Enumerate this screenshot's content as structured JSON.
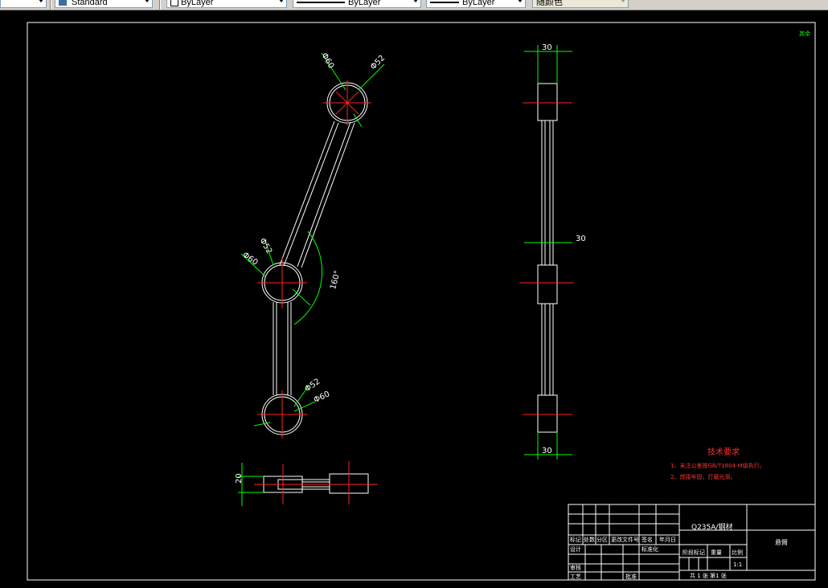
{
  "toolbar": {
    "combo1_value": "",
    "text_style": "Standard",
    "layer": "ByLayer",
    "linetype": "ByLayer",
    "lineweight": "ByLayer",
    "plot_style": "随颜色"
  },
  "drawing": {
    "corner_label": "其余",
    "dims": {
      "top_d60": "Φ60",
      "top_d52": "Φ52",
      "mid_d52": "Φ52",
      "mid_d60": "Φ60",
      "angle": "160°",
      "bot_d52": "Φ52",
      "bot_d60": "Φ60",
      "side_top_30": "30",
      "side_mid_30": "30",
      "side_bot_30": "30",
      "plan_20": "20"
    },
    "tech_req_title": "技术要求",
    "tech_req_1": "1、未注公差按GB/T1804-M级执行。",
    "tech_req_2": "2、焊接牢固，打磨光滑。",
    "title_block": {
      "material": "Q235A/钢材",
      "part_name": "悬臂",
      "h_mark": "标记",
      "h_count": "处数",
      "h_zone": "分区",
      "h_doc": "更改文件号",
      "h_sign": "签名",
      "h_date": "年月日",
      "h_design": "设计",
      "h_std": "标准化",
      "h_review": "审核",
      "h_process": "工艺",
      "h_approve": "批准",
      "h_stage": "阶段标记",
      "h_weight": "重量",
      "h_scale": "比例",
      "scale_value": "1:1",
      "sheets": "共  1 张  第1 张"
    }
  }
}
